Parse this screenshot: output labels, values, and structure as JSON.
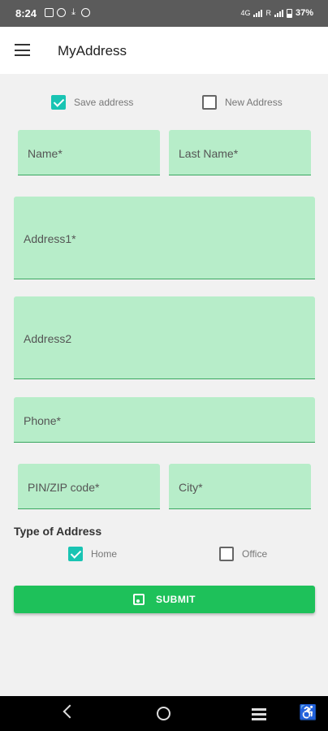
{
  "status_bar": {
    "time": "8:24",
    "network_1": "4G",
    "network_2": "R",
    "battery": "37%"
  },
  "app_bar": {
    "title": "MyAddress"
  },
  "address_options": {
    "save_address": {
      "label": "Save address",
      "checked": true
    },
    "new_address": {
      "label": "New Address",
      "checked": false
    }
  },
  "form": {
    "name": {
      "placeholder": "Name*"
    },
    "last_name": {
      "placeholder": "Last Name*"
    },
    "address1": {
      "placeholder": "Address1*"
    },
    "address2": {
      "placeholder": "Address2"
    },
    "phone": {
      "placeholder": "Phone*"
    },
    "pin": {
      "placeholder": "PIN/ZIP code*"
    },
    "city": {
      "placeholder": "City*"
    }
  },
  "address_type": {
    "title": "Type of Address",
    "home": {
      "label": "Home",
      "checked": true
    },
    "office": {
      "label": "Office",
      "checked": false
    }
  },
  "submit": {
    "label": "SUBMIT"
  },
  "colors": {
    "field_bg": "#b7edc9",
    "accent": "#19c4b3",
    "submit_bg": "#1ec15a"
  }
}
